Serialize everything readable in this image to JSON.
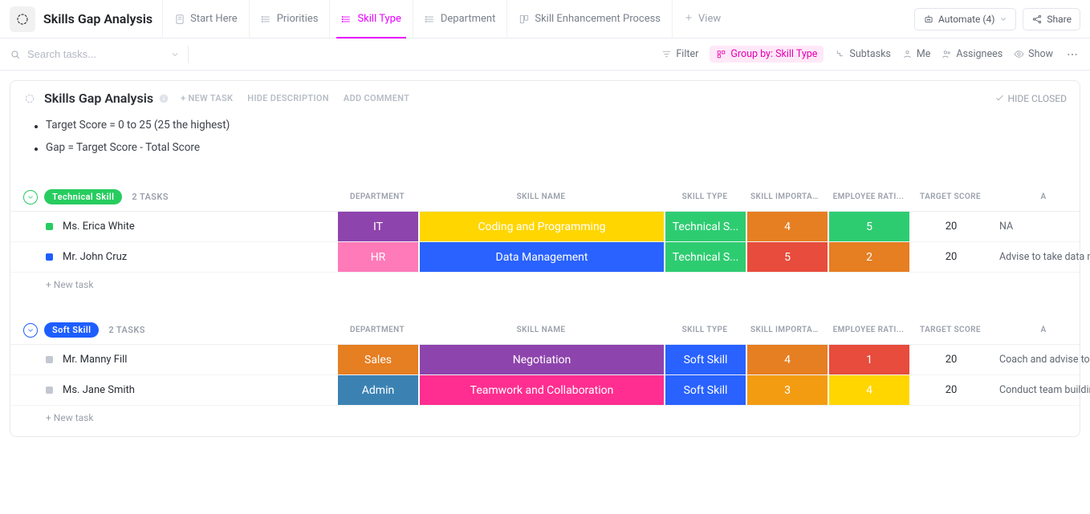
{
  "header": {
    "page_title": "Skills Gap Analysis",
    "tabs": [
      {
        "label": "Start Here",
        "icon": "doc"
      },
      {
        "label": "Priorities",
        "icon": "list"
      },
      {
        "label": "Skill Type",
        "icon": "list",
        "active": true
      },
      {
        "label": "Department",
        "icon": "list"
      },
      {
        "label": "Skill Enhancement Process",
        "icon": "board"
      }
    ],
    "add_view_label": "View",
    "automate_label": "Automate",
    "automate_count": "(4)",
    "share_label": "Share"
  },
  "toolbar": {
    "search_placeholder": "Search tasks...",
    "filter_label": "Filter",
    "group_by_label": "Group by: Skill Type",
    "subtasks_label": "Subtasks",
    "me_label": "Me",
    "assignees_label": "Assignees",
    "show_label": "Show"
  },
  "board": {
    "title": "Skills Gap Analysis",
    "new_task_btn": "+ NEW TASK",
    "hide_desc_btn": "HIDE DESCRIPTION",
    "add_comment_btn": "ADD COMMENT",
    "hide_closed_label": "HIDE CLOSED",
    "description": [
      "Target Score = 0 to 25 (25 the highest)",
      "Gap = Target Score - Total Score"
    ]
  },
  "columns": {
    "department": "DEPARTMENT",
    "skill_name": "SKILL NAME",
    "skill_type": "SKILL TYPE",
    "skill_importance": "SKILL IMPORTAN...",
    "employee_rating": "EMPLOYEE RATI...",
    "target_score": "TARGET SCORE",
    "action": "A"
  },
  "new_task_row": "+ New task",
  "groups": [
    {
      "name": "Technical Skill",
      "badge_color": "badge-green",
      "chevron_color": "#27cc5f",
      "count_label": "2 TASKS",
      "rows": [
        {
          "status_color": "#27cc5f",
          "name": "Ms. Erica White",
          "department": {
            "text": "IT",
            "color": "c-purple"
          },
          "skill_name": {
            "text": "Coding and Programming",
            "color": "c-yellow"
          },
          "skill_type": {
            "text": "Technical S...",
            "color": "c-green"
          },
          "importance": {
            "text": "4",
            "color": "c-orange"
          },
          "rating": {
            "text": "5",
            "color": "c-green"
          },
          "target": "20",
          "action": "NA"
        },
        {
          "status_color": "#1e5eff",
          "name": "Mr. John Cruz",
          "department": {
            "text": "HR",
            "color": "c-pink"
          },
          "skill_name": {
            "text": "Data Management",
            "color": "c-royalblue"
          },
          "skill_type": {
            "text": "Technical S...",
            "color": "c-green"
          },
          "importance": {
            "text": "5",
            "color": "c-red"
          },
          "rating": {
            "text": "2",
            "color": "c-orange"
          },
          "target": "20",
          "action": "Advise to take data mana"
        }
      ]
    },
    {
      "name": "Soft Skill",
      "badge_color": "badge-blue",
      "chevron_color": "#1e5eff",
      "count_label": "2 TASKS",
      "rows": [
        {
          "status_color": "#c2c7d1",
          "name": "Mr. Manny Fill",
          "department": {
            "text": "Sales",
            "color": "c-orange"
          },
          "skill_name": {
            "text": "Negotiation",
            "color": "c-purple"
          },
          "skill_type": {
            "text": "Soft Skill",
            "color": "c-royalblue"
          },
          "importance": {
            "text": "4",
            "color": "c-orange"
          },
          "rating": {
            "text": "1",
            "color": "c-red"
          },
          "target": "20",
          "action": "Coach and advise to take"
        },
        {
          "status_color": "#c2c7d1",
          "name": "Ms. Jane Smith",
          "department": {
            "text": "Admin",
            "color": "c-steel"
          },
          "skill_name": {
            "text": "Teamwork and Collaboration",
            "color": "c-hotpink"
          },
          "skill_type": {
            "text": "Soft Skill",
            "color": "c-royalblue"
          },
          "importance": {
            "text": "3",
            "color": "c-orange2"
          },
          "rating": {
            "text": "4",
            "color": "c-yellow"
          },
          "target": "20",
          "action": "Conduct team building ac"
        }
      ]
    }
  ]
}
